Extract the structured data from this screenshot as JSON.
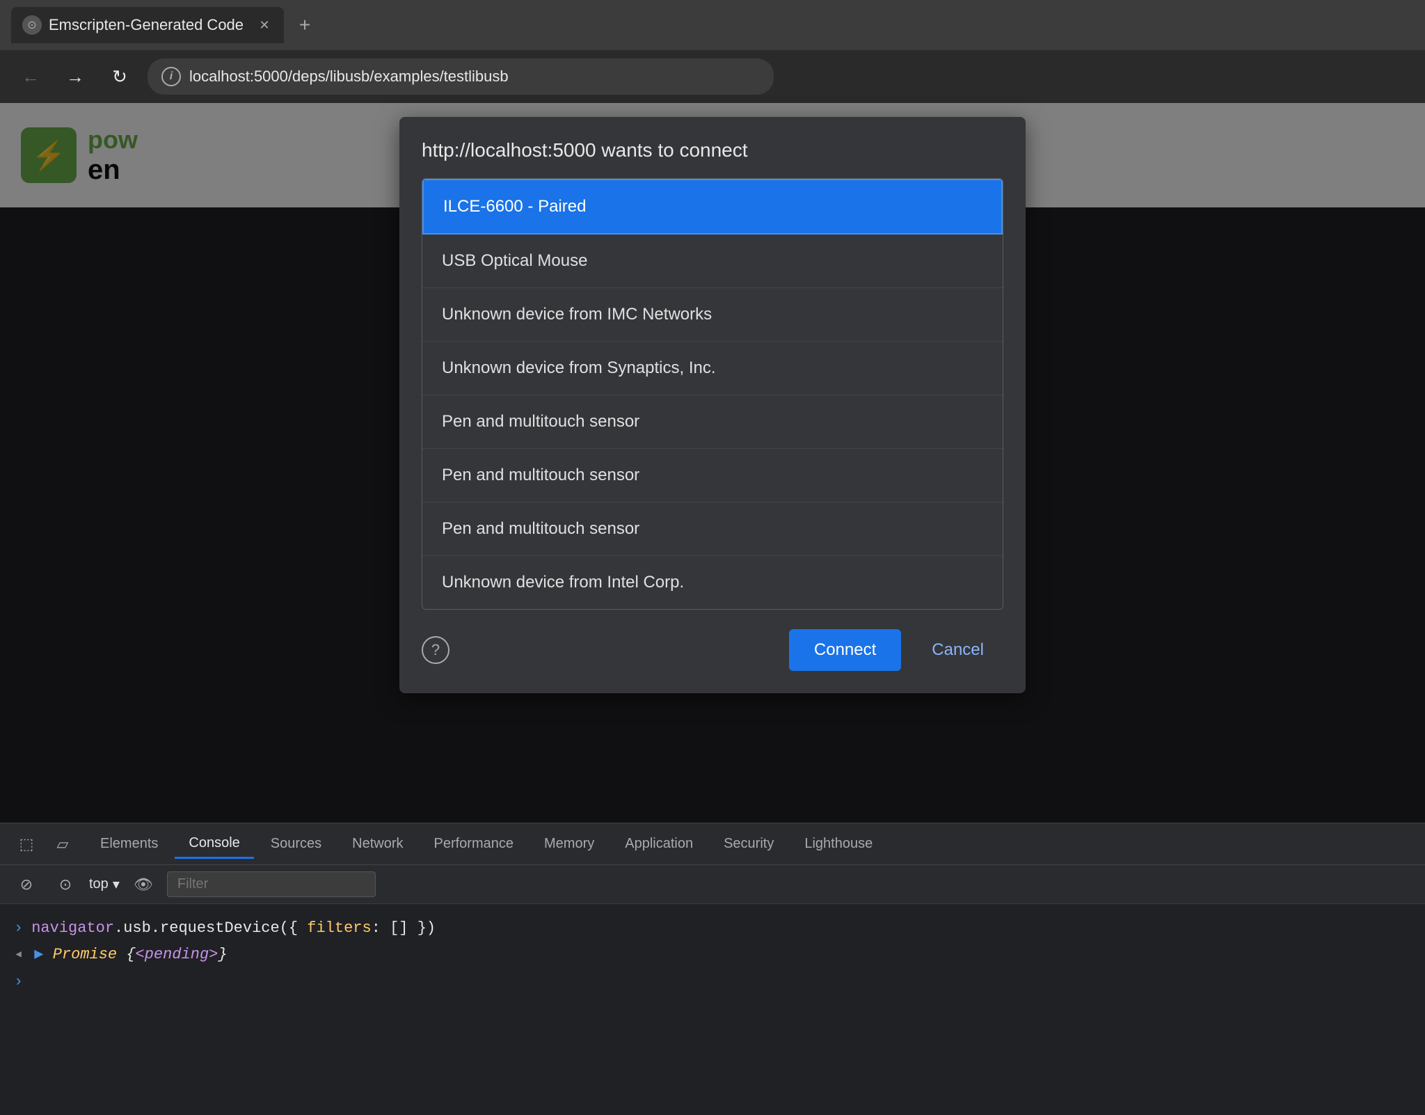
{
  "browser": {
    "tab_title": "Emscripten-Generated Code",
    "url": "localhost:5000/deps/libusb/examples/testlibusb",
    "new_tab_label": "+",
    "back_label": "←",
    "forward_label": "→",
    "refresh_label": "↻"
  },
  "dialog": {
    "title": "http://localhost:5000 wants to connect",
    "devices": [
      {
        "name": "ILCE-6600 - Paired",
        "selected": true
      },
      {
        "name": "USB Optical Mouse",
        "selected": false
      },
      {
        "name": "Unknown device from IMC Networks",
        "selected": false
      },
      {
        "name": "Unknown device from Synaptics, Inc.",
        "selected": false
      },
      {
        "name": "Pen and multitouch sensor",
        "selected": false
      },
      {
        "name": "Pen and multitouch sensor",
        "selected": false
      },
      {
        "name": "Pen and multitouch sensor",
        "selected": false
      },
      {
        "name": "Unknown device from Intel Corp.",
        "selected": false
      }
    ],
    "connect_label": "Connect",
    "cancel_label": "Cancel"
  },
  "devtools": {
    "tabs": [
      {
        "label": "Elements",
        "active": false
      },
      {
        "label": "Console",
        "active": true
      },
      {
        "label": "Sources",
        "active": false
      },
      {
        "label": "Network",
        "active": false
      },
      {
        "label": "Performance",
        "active": false
      },
      {
        "label": "Memory",
        "active": false
      },
      {
        "label": "Application",
        "active": false
      },
      {
        "label": "Security",
        "active": false
      },
      {
        "label": "Lighthouse",
        "active": false
      }
    ],
    "filter_placeholder": "Filter",
    "top_label": "top",
    "console_input": "navigator.usb.requestDevice({ filters: [] })",
    "console_output": "Promise {<pending>}"
  },
  "logo": {
    "icon": "⚡",
    "text_green": "pow",
    "text_black": "en"
  }
}
